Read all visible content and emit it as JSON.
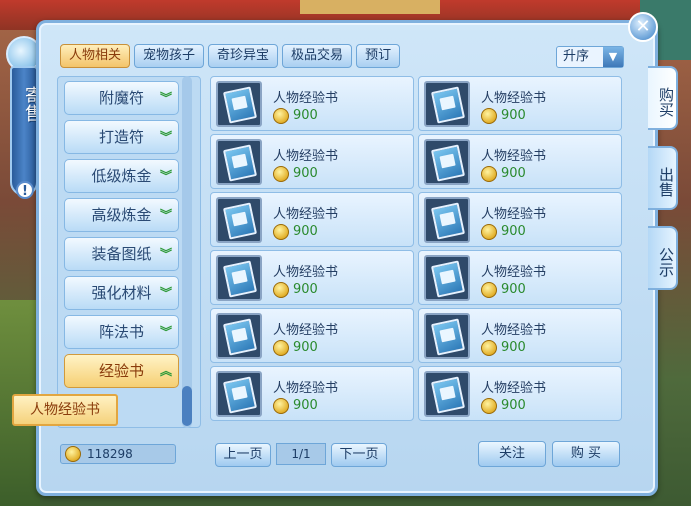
{
  "ribbon": {
    "title": "寄售",
    "badge": "!"
  },
  "close_icon": "✕",
  "tabs": [
    {
      "label": "人物相关",
      "active": true
    },
    {
      "label": "宠物孩子",
      "active": false
    },
    {
      "label": "奇珍异宝",
      "active": false
    },
    {
      "label": "极品交易",
      "active": false
    },
    {
      "label": "预订",
      "active": false
    }
  ],
  "sort": {
    "selected": "升序",
    "arrow": "▼"
  },
  "side_tabs": [
    {
      "label": "购买",
      "active": true
    },
    {
      "label": "出售",
      "active": false
    },
    {
      "label": "公示",
      "active": false
    }
  ],
  "categories": [
    {
      "label": "附魔符",
      "arrow": "︾"
    },
    {
      "label": "打造符",
      "arrow": "︾"
    },
    {
      "label": "低级炼金",
      "arrow": "︾"
    },
    {
      "label": "高级炼金",
      "arrow": "︾"
    },
    {
      "label": "装备图纸",
      "arrow": "︾"
    },
    {
      "label": "强化材料",
      "arrow": "︾"
    },
    {
      "label": "阵法书",
      "arrow": "︾"
    },
    {
      "label": "经验书",
      "arrow": "︽"
    }
  ],
  "sub_category": "人物经验书",
  "goods": [
    {
      "name": "人物经验书",
      "price": "900"
    },
    {
      "name": "人物经验书",
      "price": "900"
    },
    {
      "name": "人物经验书",
      "price": "900"
    },
    {
      "name": "人物经验书",
      "price": "900"
    },
    {
      "name": "人物经验书",
      "price": "900"
    },
    {
      "name": "人物经验书",
      "price": "900"
    },
    {
      "name": "人物经验书",
      "price": "900"
    },
    {
      "name": "人物经验书",
      "price": "900"
    },
    {
      "name": "人物经验书",
      "price": "900"
    },
    {
      "name": "人物经验书",
      "price": "900"
    },
    {
      "name": "人物经验书",
      "price": "900"
    },
    {
      "name": "人物经验书",
      "price": "900"
    }
  ],
  "money": "118298",
  "pager": {
    "prev": "上一页",
    "indicator": "1/1",
    "next": "下一页"
  },
  "actions": {
    "follow": "关注",
    "buy": "购 买"
  },
  "colors": {
    "accent_gold": "#f3c46a",
    "panel_blue": "#b7d6f0",
    "price_green": "#2a8a2e"
  }
}
